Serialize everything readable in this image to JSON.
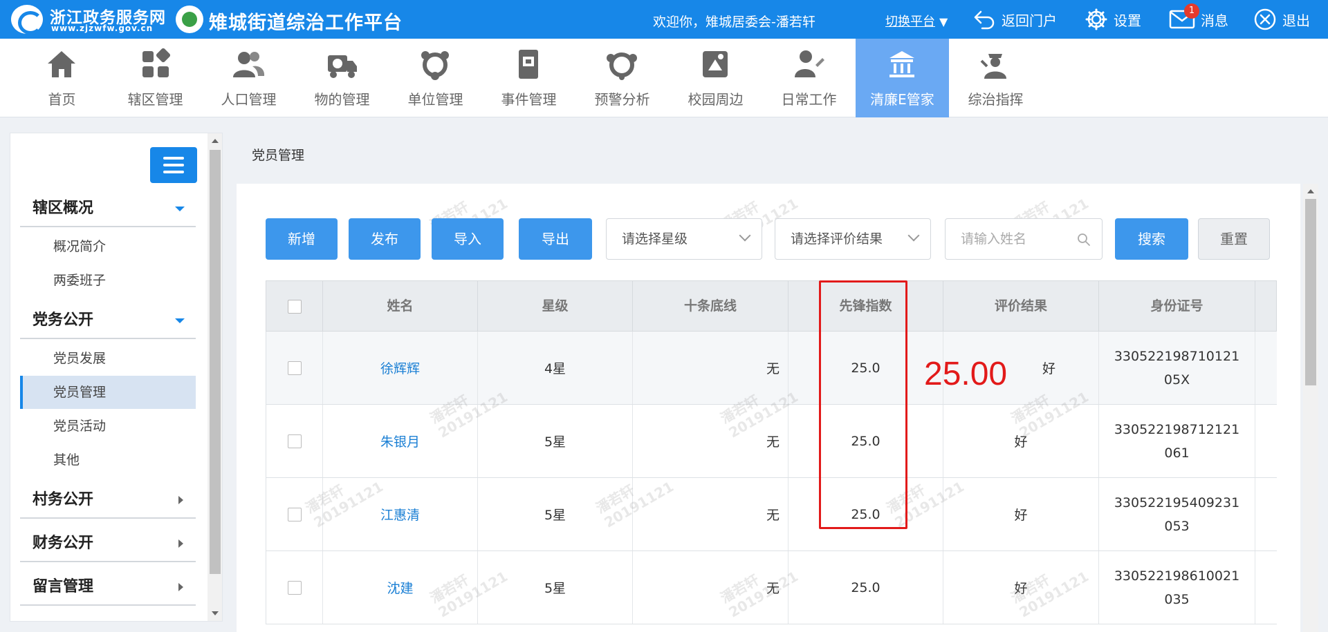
{
  "header": {
    "site_name": "浙江政务服务网",
    "site_url": "www.zjzwfw.gov.cn",
    "platform_name": "雉城街道综治工作平台",
    "welcome": "欢迎你，雉城居委会-潘若轩",
    "switch_platform": "切换平台",
    "return_portal": "返回门户",
    "settings": "设置",
    "messages": "消息",
    "message_count": "1",
    "logout": "退出",
    "brand_color": "#1787e8"
  },
  "nav": {
    "items": [
      {
        "label": "首页",
        "icon": "home-icon"
      },
      {
        "label": "辖区管理",
        "icon": "grid-icon"
      },
      {
        "label": "人口管理",
        "icon": "people-icon"
      },
      {
        "label": "物的管理",
        "icon": "truck-icon"
      },
      {
        "label": "单位管理",
        "icon": "unit-icon"
      },
      {
        "label": "事件管理",
        "icon": "book-icon"
      },
      {
        "label": "预警分析",
        "icon": "alert-icon"
      },
      {
        "label": "校园周边",
        "icon": "campus-icon"
      },
      {
        "label": "日常工作",
        "icon": "user-pen-icon"
      },
      {
        "label": "清廉E管家",
        "icon": "integrity-icon",
        "active": true
      },
      {
        "label": "综治指挥",
        "icon": "commander-icon"
      }
    ],
    "active_color": "#6aa9f3"
  },
  "sidebar": {
    "groups": [
      {
        "label": "辖区概况",
        "expanded": true,
        "items": [
          "概况简介",
          "两委班子"
        ]
      },
      {
        "label": "党务公开",
        "expanded": true,
        "items": [
          "党员发展",
          "党员管理",
          "党员活动",
          "其他"
        ],
        "active_item": "党员管理"
      },
      {
        "label": "村务公开",
        "expanded": false,
        "items": []
      },
      {
        "label": "财务公开",
        "expanded": false,
        "items": []
      },
      {
        "label": "留言管理",
        "expanded": false,
        "items": []
      }
    ]
  },
  "content": {
    "breadcrumb": "党员管理",
    "toolbar": {
      "add": "新增",
      "publish": "发布",
      "import": "导入",
      "export": "导出",
      "star_select": "请选择星级",
      "result_select": "请选择评价结果",
      "name_placeholder": "请输入姓名",
      "search": "搜索",
      "reset": "重置"
    },
    "table": {
      "headers": [
        "姓名",
        "星级",
        "十条底线",
        "先锋指数",
        "评价结果",
        "身份证号"
      ],
      "rows": [
        {
          "name": "徐辉辉",
          "star": "4星",
          "bottom_line": "无",
          "index": "25.0",
          "result": "好",
          "id": "33052219871012105X"
        },
        {
          "name": "朱银月",
          "star": "5星",
          "bottom_line": "无",
          "index": "25.0",
          "result": "好",
          "id": "330522198712121061"
        },
        {
          "name": "江惠清",
          "star": "5星",
          "bottom_line": "无",
          "index": "25.0",
          "result": "好",
          "id": "330522195409231053"
        },
        {
          "name": "沈建",
          "star": "5星",
          "bottom_line": "无",
          "index": "25.0",
          "result": "好",
          "id": "330522198610021035"
        }
      ]
    },
    "annotation": "25.00",
    "annotation_color": "#e21a1a",
    "watermark": [
      "潘若轩",
      "20191121"
    ]
  }
}
